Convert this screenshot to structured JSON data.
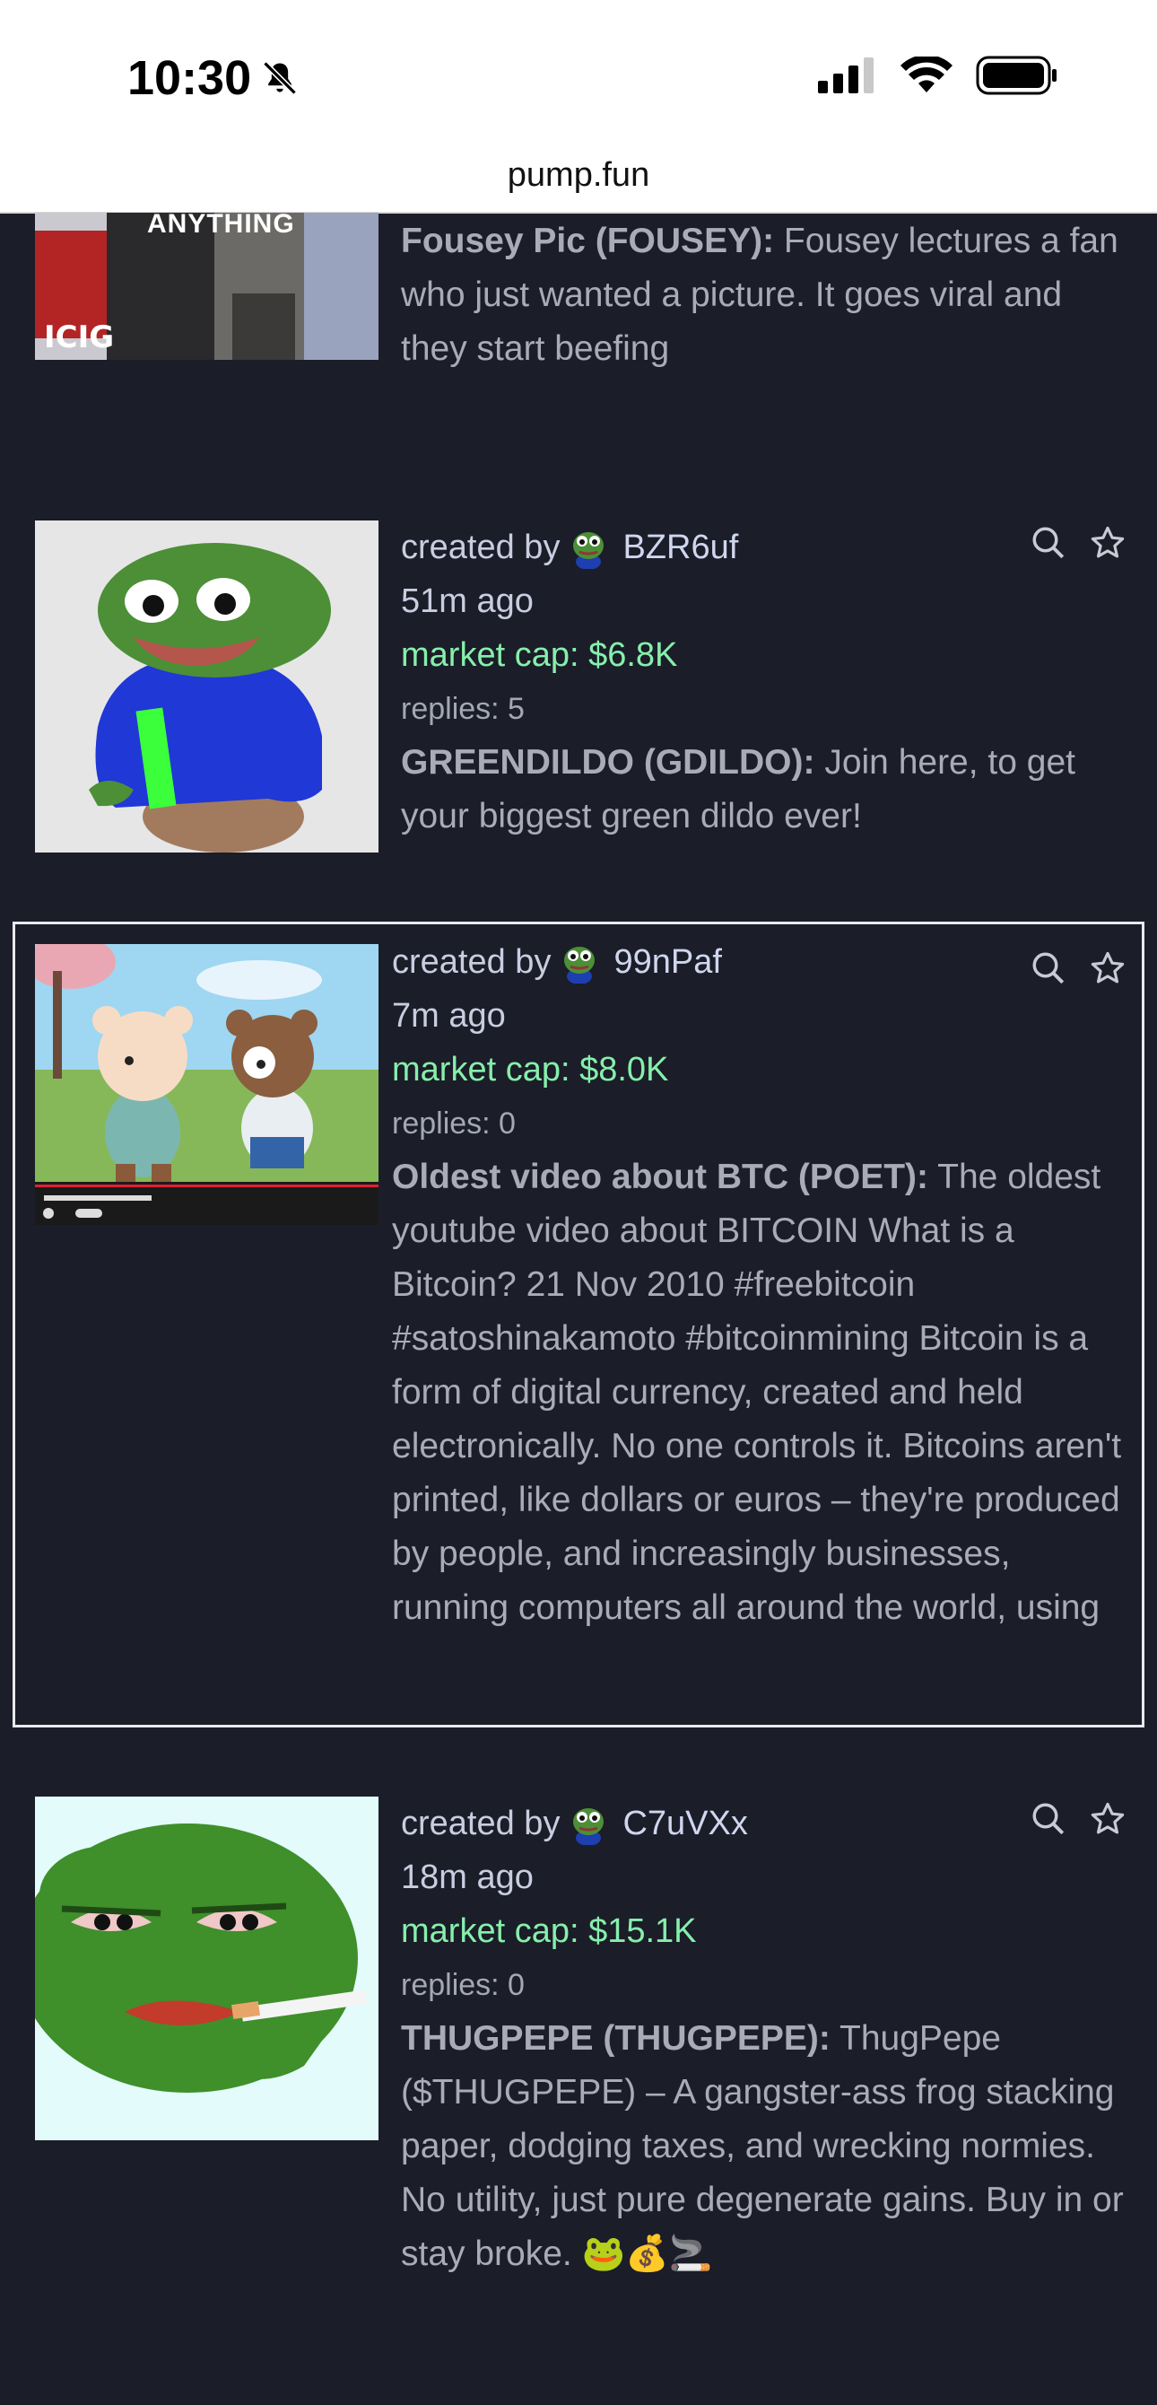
{
  "status": {
    "time": "10:30"
  },
  "browser": {
    "url": "pump.fun"
  },
  "cards": [
    {
      "name_symbol": "Fousey Pic (FOUSEY):",
      "description": "Fousey lectures a fan who just wanted a picture. It goes viral and they start beefing",
      "thumb_text": "ANYTHING"
    },
    {
      "created_prefix": "created by",
      "creator": "BZR6uf",
      "age": "51m ago",
      "market_cap": "market cap: $6.8K",
      "replies": "replies: 5",
      "name_symbol": "GREENDILDO (GDILDO):",
      "description": "Join here, to get your biggest green dildo ever!"
    },
    {
      "created_prefix": "created by",
      "creator": "99nPaf",
      "age": "7m ago",
      "market_cap": "market cap: $8.0K",
      "replies": "replies: 0",
      "name_symbol": "Oldest video about BTC (POET):",
      "description": "The oldest youtube video about BITCOIN What is a Bitcoin? 21 Nov 2010 #freebitcoin #satoshinakamoto #bitcoinmining Bitcoin is a form of digital currency, created and held electronically. No one controls it. Bitcoins aren't printed, like dollars or euros – they're produced by people, and increasingly businesses, running computers all around the world, using"
    },
    {
      "created_prefix": "created by",
      "creator": "C7uVXx",
      "age": "18m ago",
      "market_cap": "market cap: $15.1K",
      "replies": "replies: 0",
      "name_symbol": "THUGPEPE (THUGPEPE):",
      "description": "ThugPepe ($THUGPEPE) – A gangster-ass frog stacking paper, dodging taxes, and wrecking normies. No utility, just pure degenerate gains. Buy in or stay broke.",
      "emojis": "🐸💰🚬"
    }
  ],
  "colors": {
    "background": "#1b1d28",
    "market_cap": "#86efac",
    "text": "#a9acb8"
  }
}
